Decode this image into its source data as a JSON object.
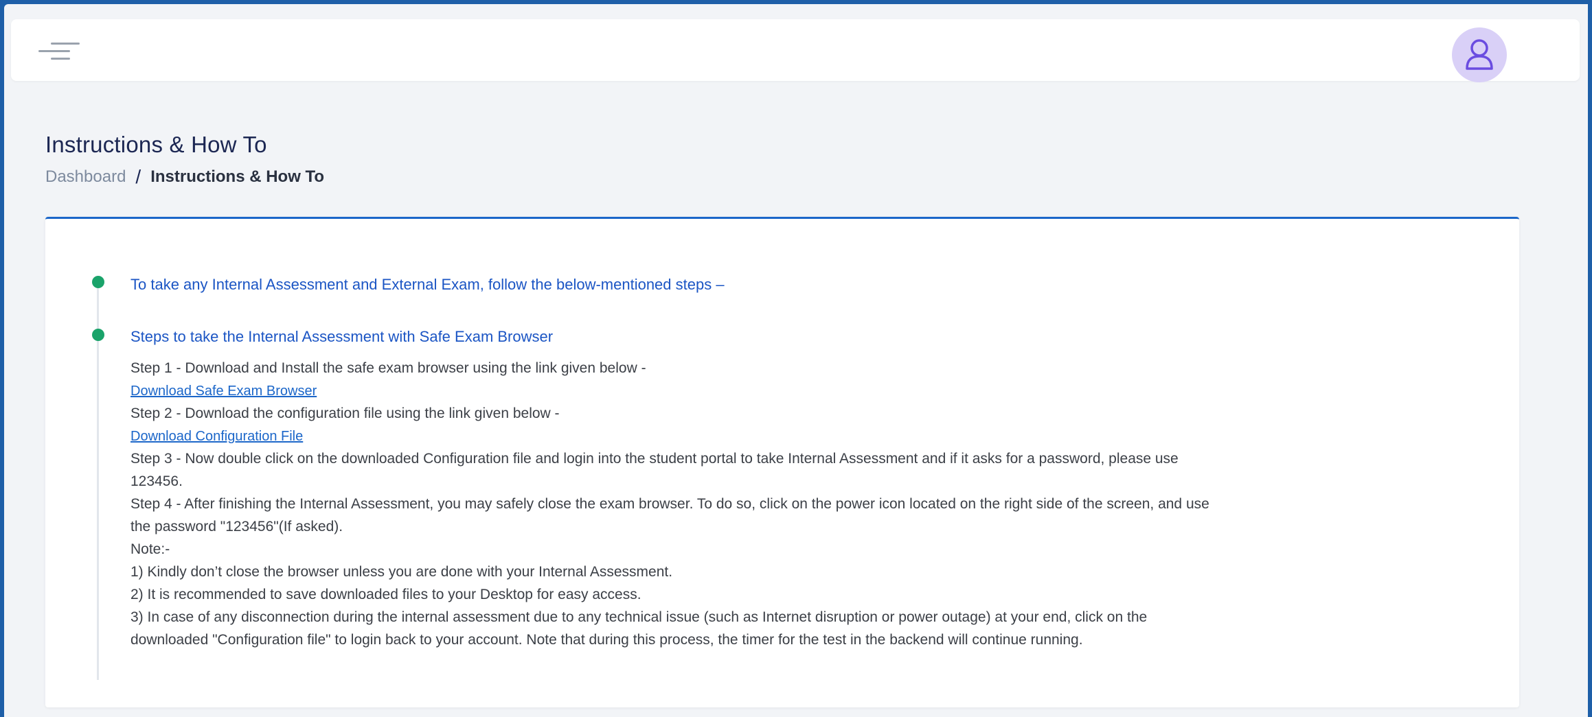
{
  "header": {
    "menu_icon": "hamburger-menu-icon",
    "avatar_icon": "user-icon"
  },
  "page": {
    "title": "Instructions & How To",
    "breadcrumb": {
      "home": "Dashboard",
      "separator": "/",
      "current": "Instructions & How To"
    }
  },
  "instructions": {
    "heading_1": "To take any Internal Assessment and External Exam, follow the below-mentioned steps –",
    "heading_2": "Steps to take the Internal Assessment with Safe Exam Browser",
    "step_1": "Step 1 - Download and Install the safe exam browser using the link given below -",
    "link_1": "Download Safe Exam Browser",
    "step_2": "Step 2 - Download the configuration file using the link given below -",
    "link_2": "Download Configuration File",
    "step_3_line1": "Step 3 - Now double click on the downloaded Configuration file and login into the student portal to take Internal Assessment and if it asks for a password, please use",
    "step_3_line2": "123456.",
    "step_4_line1": "Step 4 - After finishing the Internal Assessment, you may safely close the exam browser. To do so, click on the power icon located on the right side of the screen, and use",
    "step_4_line2": "the password \"123456\"(If asked).",
    "note_label": "Note:-",
    "note_1": "1) Kindly don’t close the browser unless you are done with your Internal Assessment.",
    "note_2": "2) It is recommended to save downloaded files to your Desktop for easy access.",
    "note_3_line1": "3) In case of any disconnection during the internal assessment due to any technical issue (such as Internet disruption or power outage) at your end, click on the",
    "note_3_line2": "downloaded \"Configuration file\" to login back to your account. Note that during this process, the timer for the test in the backend will continue running."
  },
  "colors": {
    "accent": "#1b66c9",
    "timeline_dot": "#1aa36a",
    "heading_text": "#1b55c4",
    "avatar_bg": "#d9d0f7"
  }
}
